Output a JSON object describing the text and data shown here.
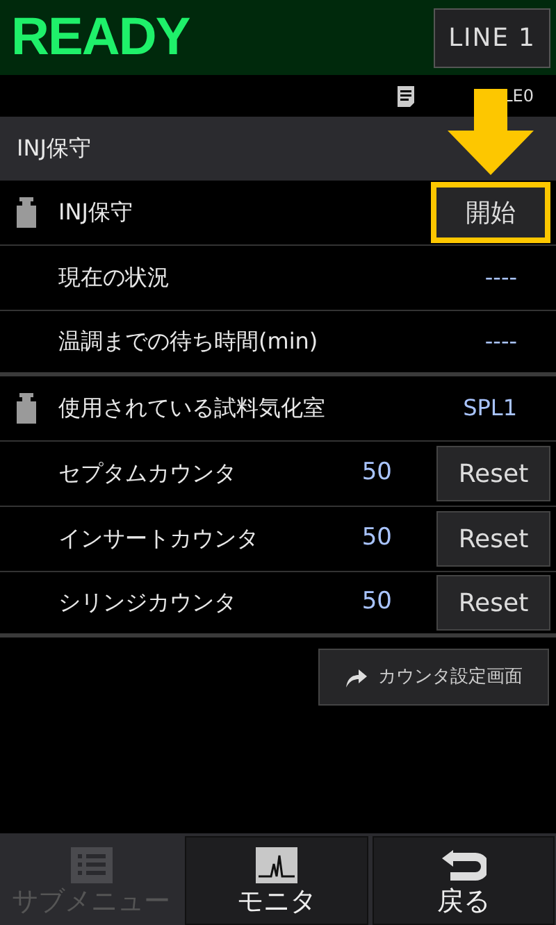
{
  "header": {
    "status": "READY",
    "line_button": "LINE 1"
  },
  "file_label": "LE0",
  "section_title": "INJ保守",
  "rows": [
    {
      "kind": "action",
      "icon": true,
      "label": "INJ保守",
      "button": "開始",
      "highlighted": true
    },
    {
      "kind": "value",
      "icon": false,
      "label": "現在の状況",
      "value": "----"
    },
    {
      "kind": "value",
      "icon": false,
      "label": "温調までの待ち時間(min)",
      "value": "----",
      "group_end": true
    },
    {
      "kind": "value",
      "icon": true,
      "label": "使用されている試料気化室",
      "value": "SPL1"
    },
    {
      "kind": "counter",
      "icon": false,
      "label": "セプタムカウンタ",
      "value": "50",
      "button": "Reset"
    },
    {
      "kind": "counter",
      "icon": false,
      "label": "インサートカウンタ",
      "value": "50",
      "button": "Reset"
    },
    {
      "kind": "counter",
      "icon": false,
      "label": "シリンジカウンタ",
      "value": "50",
      "button": "Reset",
      "group_end": true
    }
  ],
  "settings_button": "カウンタ設定画面",
  "bottom_buttons": [
    {
      "kind": "submenu",
      "label": "サブメニュー",
      "disabled": true
    },
    {
      "kind": "monitor",
      "label": "モニタ",
      "disabled": false
    },
    {
      "kind": "back",
      "label": "戻る",
      "disabled": false
    }
  ]
}
